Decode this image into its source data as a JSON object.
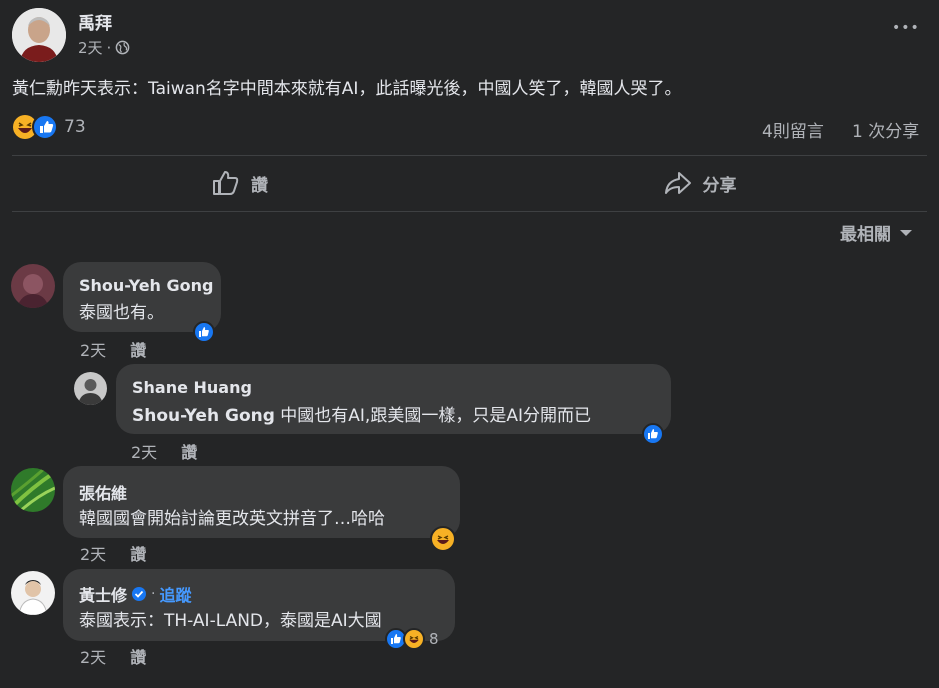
{
  "post": {
    "author": "禹拜",
    "time": "2天",
    "privacy_sep": "·",
    "more": "•••",
    "text": "黃仁勳昨天表示：Taiwan名字中間本來就有AI，此話曝光後，中國人笑了，韓國人哭了。",
    "reaction_count": "73",
    "comments_count": "4則留言",
    "shares_count": "1 次分享"
  },
  "actions": {
    "like": "讚",
    "share": "分享"
  },
  "sort": {
    "label": "最相關"
  },
  "comments": [
    {
      "name": "Shou-Yeh Gong",
      "text": "泰國也有。",
      "time": "2天",
      "like": "讚"
    },
    {
      "name": "Shane Huang",
      "mention": "Shou-Yeh Gong",
      "text": " 中國也有AI,跟美國一樣，只是AI分開而已",
      "time": "2天",
      "like": "讚"
    },
    {
      "name": "張佑維",
      "text": "韓國國會開始討論更改英文拼音了…哈哈",
      "time": "2天",
      "like": "讚"
    },
    {
      "name": "黃士修",
      "follow_sep": "·",
      "follow": "追蹤",
      "text": "泰國表示：TH-AI-LAND，泰國是AI大國",
      "reaction_count": "8",
      "time": "2天",
      "like": "讚"
    }
  ],
  "colors": {
    "background": "#242526",
    "bubble": "#3a3b3c",
    "like_blue": "#1877f2",
    "link_blue": "#4599ff",
    "secondary_text": "#b0b3b8"
  }
}
